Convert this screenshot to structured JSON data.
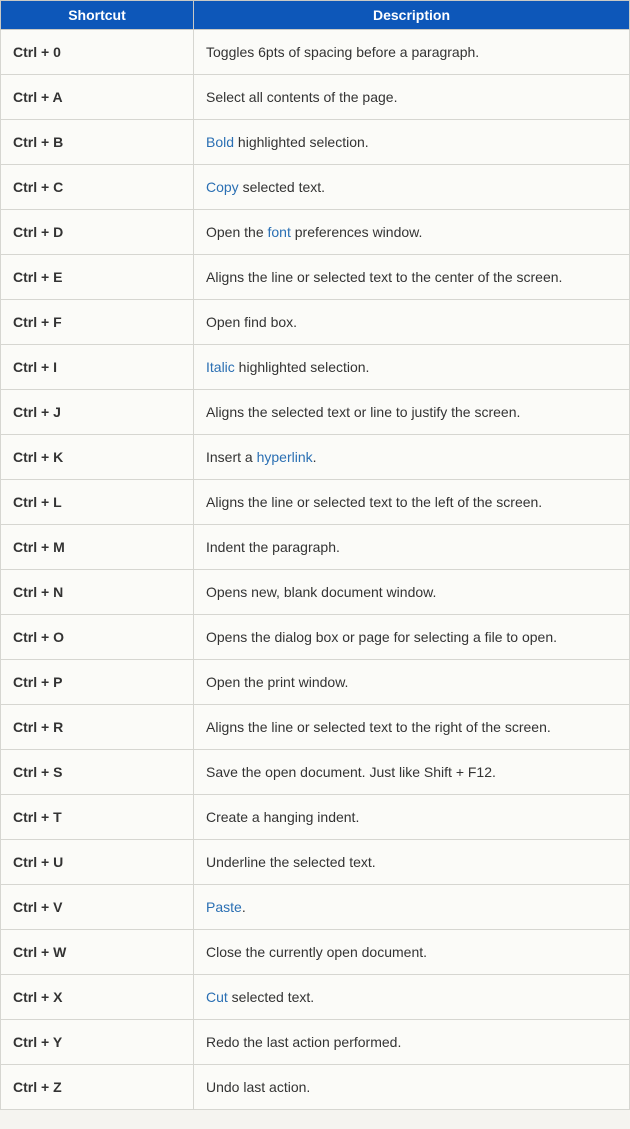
{
  "headers": {
    "shortcut": "Shortcut",
    "description": "Description"
  },
  "rows": [
    {
      "shortcut": "Ctrl + 0",
      "desc": [
        {
          "t": "Toggles 6pts of spacing before a paragraph."
        }
      ]
    },
    {
      "shortcut": "Ctrl + A",
      "desc": [
        {
          "t": "Select all contents of the page."
        }
      ]
    },
    {
      "shortcut": "Ctrl + B",
      "desc": [
        {
          "t": "Bold",
          "link": true
        },
        {
          "t": " highlighted selection."
        }
      ]
    },
    {
      "shortcut": "Ctrl + C",
      "desc": [
        {
          "t": "Copy",
          "link": true
        },
        {
          "t": " selected text."
        }
      ]
    },
    {
      "shortcut": "Ctrl + D",
      "desc": [
        {
          "t": "Open the "
        },
        {
          "t": "font",
          "link": true
        },
        {
          "t": " preferences window."
        }
      ]
    },
    {
      "shortcut": "Ctrl + E",
      "desc": [
        {
          "t": "Aligns the line or selected text to the center of the screen."
        }
      ]
    },
    {
      "shortcut": "Ctrl + F",
      "desc": [
        {
          "t": "Open find box."
        }
      ]
    },
    {
      "shortcut": "Ctrl + I",
      "desc": [
        {
          "t": "Italic",
          "link": true
        },
        {
          "t": " highlighted selection."
        }
      ]
    },
    {
      "shortcut": "Ctrl + J",
      "desc": [
        {
          "t": "Aligns the selected text or line to justify the screen."
        }
      ]
    },
    {
      "shortcut": "Ctrl + K",
      "desc": [
        {
          "t": "Insert a "
        },
        {
          "t": "hyperlink",
          "link": true
        },
        {
          "t": "."
        }
      ]
    },
    {
      "shortcut": "Ctrl + L",
      "desc": [
        {
          "t": "Aligns the line or selected text to the left of the screen."
        }
      ]
    },
    {
      "shortcut": "Ctrl + M",
      "desc": [
        {
          "t": "Indent the paragraph."
        }
      ]
    },
    {
      "shortcut": "Ctrl + N",
      "desc": [
        {
          "t": "Opens new, blank document window."
        }
      ]
    },
    {
      "shortcut": "Ctrl + O",
      "desc": [
        {
          "t": "Opens the dialog box or page for selecting a file to open."
        }
      ]
    },
    {
      "shortcut": "Ctrl + P",
      "desc": [
        {
          "t": "Open the print window."
        }
      ]
    },
    {
      "shortcut": "Ctrl + R",
      "desc": [
        {
          "t": "Aligns the line or selected text to the right of the screen."
        }
      ]
    },
    {
      "shortcut": "Ctrl + S",
      "desc": [
        {
          "t": "Save the open document. Just like Shift + F12."
        }
      ]
    },
    {
      "shortcut": "Ctrl + T",
      "desc": [
        {
          "t": "Create a hanging indent."
        }
      ]
    },
    {
      "shortcut": "Ctrl + U",
      "desc": [
        {
          "t": "Underline the selected text."
        }
      ]
    },
    {
      "shortcut": "Ctrl + V",
      "desc": [
        {
          "t": "Paste",
          "link": true
        },
        {
          "t": "."
        }
      ]
    },
    {
      "shortcut": "Ctrl + W",
      "desc": [
        {
          "t": "Close the currently open document."
        }
      ]
    },
    {
      "shortcut": "Ctrl + X",
      "desc": [
        {
          "t": "Cut",
          "link": true
        },
        {
          "t": " selected text."
        }
      ]
    },
    {
      "shortcut": "Ctrl + Y",
      "desc": [
        {
          "t": "Redo the last action performed."
        }
      ]
    },
    {
      "shortcut": "Ctrl + Z",
      "desc": [
        {
          "t": "Undo last action."
        }
      ]
    }
  ]
}
